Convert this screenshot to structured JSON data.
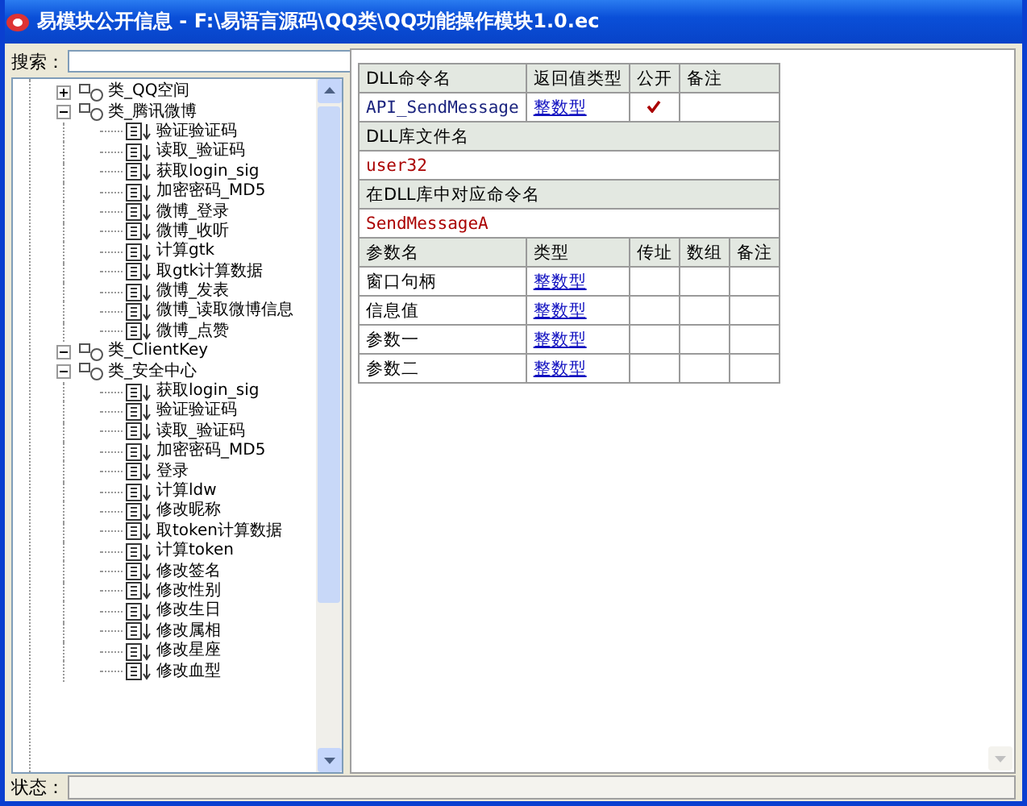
{
  "window": {
    "title": "易模块公开信息 - F:\\易语言源码\\QQ类\\QQ功能操作模块1.0.ec"
  },
  "search": {
    "label": "搜索："
  },
  "tree": [
    {
      "label": "类_QQ空间",
      "expanded": false
    },
    {
      "label": "类_腾讯微博",
      "expanded": true,
      "children": [
        {
          "label": "验证验证码"
        },
        {
          "label": "读取_验证码"
        },
        {
          "label": "获取login_sig"
        },
        {
          "label": "加密密码_MD5"
        },
        {
          "label": "微博_登录"
        },
        {
          "label": "微博_收听"
        },
        {
          "label": "计算gtk"
        },
        {
          "label": "取gtk计算数据"
        },
        {
          "label": "微博_发表"
        },
        {
          "label": "微博_读取微博信息"
        },
        {
          "label": "微博_点赞"
        }
      ]
    },
    {
      "label": "类_ClientKey",
      "expanded": true
    },
    {
      "label": "类_安全中心",
      "expanded": true,
      "children": [
        {
          "label": "获取login_sig"
        },
        {
          "label": "验证验证码"
        },
        {
          "label": "读取_验证码"
        },
        {
          "label": "加密密码_MD5"
        },
        {
          "label": "登录"
        },
        {
          "label": "计算ldw"
        },
        {
          "label": "修改昵称"
        },
        {
          "label": "取token计算数据"
        },
        {
          "label": "计算token"
        },
        {
          "label": "修改签名"
        },
        {
          "label": "修改性别"
        },
        {
          "label": "修改生日"
        },
        {
          "label": "修改属相"
        },
        {
          "label": "修改星座"
        },
        {
          "label": "修改血型"
        }
      ]
    }
  ],
  "command": {
    "headers": [
      "DLL命令名",
      "返回值类型",
      "公开",
      "备注"
    ],
    "name": "API_SendMessage",
    "return_type": "整数型",
    "public": true,
    "lib_label": "DLL库文件名",
    "lib_value": "user32",
    "cmd_label": "在DLL库中对应命令名",
    "cmd_value": "SendMessageA",
    "param_headers": [
      "参数名",
      "类型",
      "传址",
      "数组",
      "备注"
    ],
    "params": [
      {
        "name": "窗口句柄",
        "type": "整数型"
      },
      {
        "name": "信息值",
        "type": "整数型"
      },
      {
        "name": "参数一",
        "type": "整数型"
      },
      {
        "name": "参数二",
        "type": "整数型"
      }
    ]
  },
  "status": {
    "label": "状态："
  }
}
